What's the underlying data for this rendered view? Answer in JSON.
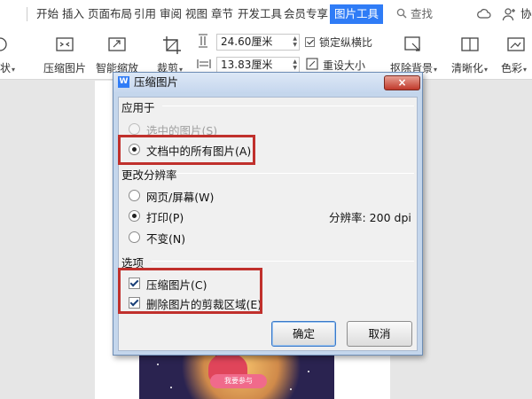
{
  "ribbon": {
    "tabs": [
      {
        "label": "开始"
      },
      {
        "label": "插入"
      },
      {
        "label": "页面布局"
      },
      {
        "label": "引用"
      },
      {
        "label": "审阅"
      },
      {
        "label": "视图"
      },
      {
        "label": "章节"
      },
      {
        "label": "开发工具"
      },
      {
        "label": "会员专享"
      },
      {
        "label": "图片工具",
        "active": true
      }
    ],
    "search_label": "查找",
    "collab_label": "协作"
  },
  "toolbar": {
    "shape_label": "形状",
    "compress_label": "压缩图片",
    "smart_zoom_label": "智能缩放",
    "crop_label": "裁剪",
    "width_value": "24.60厘米",
    "height_value": "13.83厘米",
    "lock_ratio_label": "锁定纵横比",
    "reset_size_label": "重设大小",
    "remove_bg_label": "抠除背景",
    "sharpen_label": "清晰化",
    "color_label": "色彩"
  },
  "poster": {
    "cta_label": "我要参与"
  },
  "dialog": {
    "app_icon": "W",
    "title": "压缩图片",
    "close_glyph": "×",
    "apply_to": {
      "heading": "应用于",
      "options": [
        {
          "label": "选中的图片(S)",
          "selected": false,
          "disabled": true
        },
        {
          "label": "文档中的所有图片(A)",
          "selected": true,
          "disabled": false
        }
      ]
    },
    "resolution": {
      "heading": "更改分辨率",
      "options": [
        {
          "label": "网页/屏幕(W)",
          "selected": false
        },
        {
          "label": "打印(P)",
          "selected": true
        },
        {
          "label": "不变(N)",
          "selected": false
        }
      ],
      "value_label": "分辨率: 200 dpi"
    },
    "options_group": {
      "heading": "选项",
      "checkboxes": [
        {
          "label": "压缩图片(C)",
          "checked": true
        },
        {
          "label": "删除图片的剪裁区域(E)",
          "checked": true
        }
      ]
    },
    "ok_label": "确定",
    "cancel_label": "取消"
  },
  "colors": {
    "accent": "#2f7cf6",
    "highlight": "#c0302c",
    "dialog_frame": "#c4d6ec"
  }
}
